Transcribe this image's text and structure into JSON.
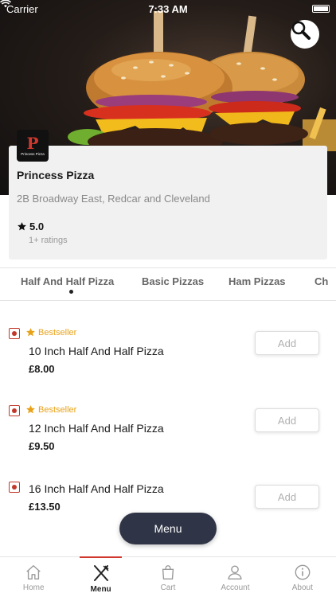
{
  "status_bar": {
    "carrier": "Carrier",
    "time": "7:33 AM"
  },
  "restaurant": {
    "logo_letter": "P",
    "logo_caption": "Princess Pizza",
    "name": "Princess Pizza",
    "address": "2B Broadway East, Redcar and Cleveland",
    "rating": "5.0",
    "ratings_count": "1+ ratings"
  },
  "categories": [
    {
      "label": "Half And Half Pizza",
      "active": true
    },
    {
      "label": "Basic Pizzas",
      "active": false
    },
    {
      "label": "Ham  Pizzas",
      "active": false
    },
    {
      "label": "Ch",
      "active": false
    }
  ],
  "items": [
    {
      "badge": "Bestseller",
      "name": "10 Inch Half And Half Pizza",
      "price": "£8.00",
      "add_label": "Add"
    },
    {
      "badge": "Bestseller",
      "name": "12 Inch Half And Half Pizza",
      "price": "£9.50",
      "add_label": "Add"
    },
    {
      "badge": "",
      "name": "16 Inch Half And Half Pizza",
      "price": "£13.50",
      "add_label": "Add"
    }
  ],
  "menu_button": "Menu",
  "tabs": [
    {
      "label": "Home",
      "icon": "home-icon"
    },
    {
      "label": "Menu",
      "icon": "fork-knife-icon",
      "active": true
    },
    {
      "label": "Cart",
      "icon": "bag-icon"
    },
    {
      "label": "Account",
      "icon": "user-icon"
    },
    {
      "label": "About",
      "icon": "info-icon"
    }
  ],
  "colors": {
    "accent": "#d1382d",
    "bestseller": "#e8a219",
    "veg_mark": "#c0392b",
    "menu_button": "#2f3546"
  }
}
